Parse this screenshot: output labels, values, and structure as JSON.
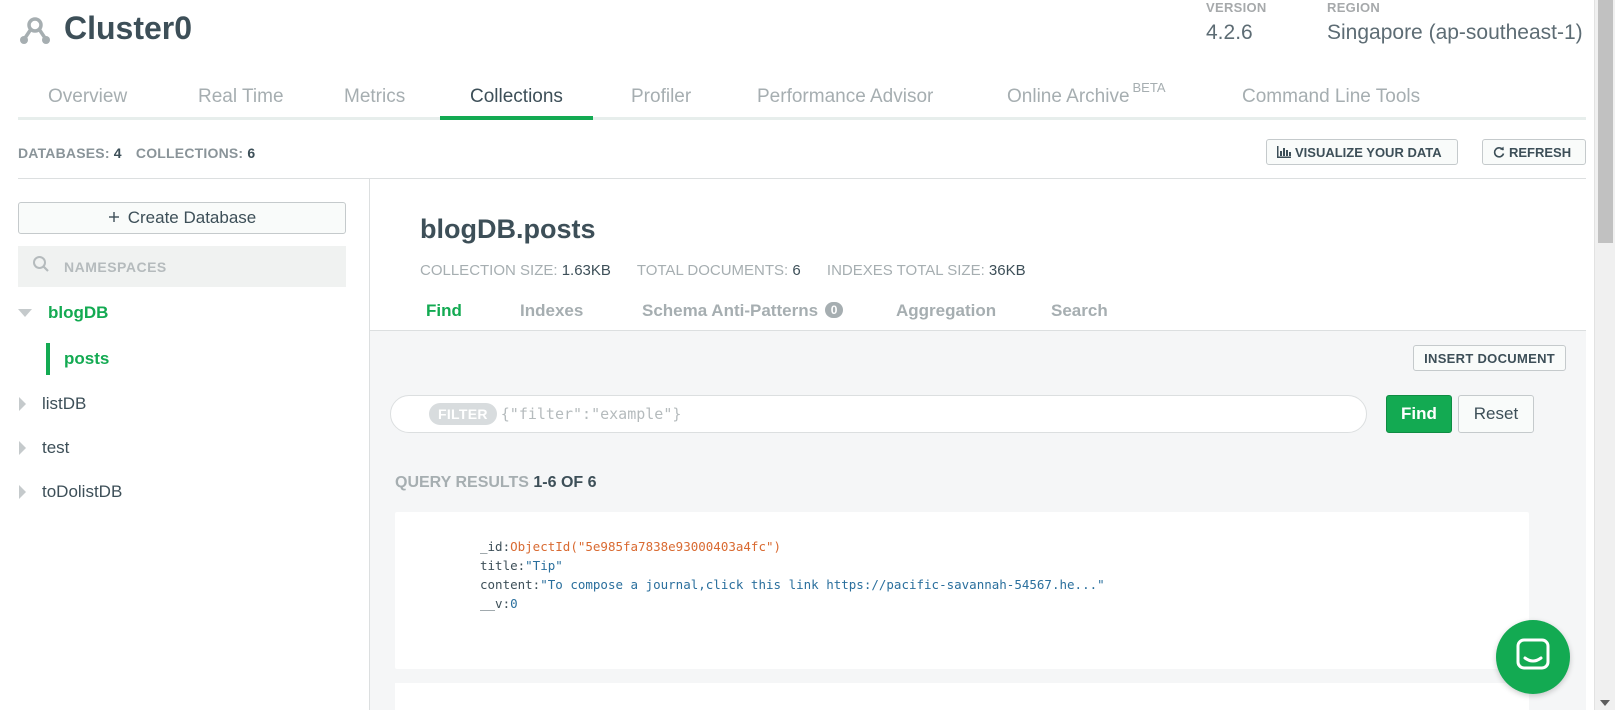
{
  "cluster": {
    "name": "Cluster0",
    "version_label": "VERSION",
    "version_value": "4.2.6",
    "region_label": "REGION",
    "region_value": "Singapore (ap-southeast-1)"
  },
  "tabs": [
    {
      "label": "Overview",
      "active": false
    },
    {
      "label": "Real Time",
      "active": false
    },
    {
      "label": "Metrics",
      "active": false
    },
    {
      "label": "Collections",
      "active": true
    },
    {
      "label": "Profiler",
      "active": false
    },
    {
      "label": "Performance Advisor",
      "active": false
    },
    {
      "label": "Online Archive",
      "sup": "BETA",
      "active": false
    },
    {
      "label": "Command Line Tools",
      "active": false
    }
  ],
  "counts": {
    "databases_label": "DATABASES:",
    "databases_value": "4",
    "collections_label": "COLLECTIONS:",
    "collections_value": "6"
  },
  "toolbar": {
    "visualize_label": "VISUALIZE YOUR DATA",
    "refresh_label": "REFRESH"
  },
  "sidebar": {
    "create_db_label": "Create Database",
    "search_placeholder": "NAMESPACES",
    "databases": [
      {
        "name": "blogDB",
        "expanded": true,
        "collections": [
          "posts"
        ]
      },
      {
        "name": "listDB",
        "expanded": false
      },
      {
        "name": "test",
        "expanded": false
      },
      {
        "name": "toDolistDB",
        "expanded": false
      }
    ]
  },
  "namespace": {
    "title": "blogDB.posts",
    "collection_size_label": "COLLECTION SIZE:",
    "collection_size_value": "1.63KB",
    "total_docs_label": "TOTAL DOCUMENTS:",
    "total_docs_value": "6",
    "indexes_size_label": "INDEXES TOTAL SIZE:",
    "indexes_size_value": "36KB"
  },
  "subtabs": [
    {
      "label": "Find",
      "active": true
    },
    {
      "label": "Indexes",
      "active": false
    },
    {
      "label": "Schema Anti-Patterns",
      "badge": "0",
      "active": false
    },
    {
      "label": "Aggregation",
      "active": false
    },
    {
      "label": "Search",
      "active": false
    }
  ],
  "query": {
    "insert_label": "INSERT DOCUMENT",
    "filter_label": "FILTER",
    "filter_placeholder": "{\"filter\":\"example\"}",
    "find_label": "Find",
    "reset_label": "Reset",
    "results_label": "QUERY RESULTS",
    "results_range": "1-6 OF 6"
  },
  "document": {
    "id_key": "_id:",
    "id_value": "ObjectId(\"5e985fa7838e93000403a4fc\")",
    "title_key": "title:",
    "title_value": "\"Tip\"",
    "content_key": "content:",
    "content_value": "\"To compose a journal,click this link https://pacific-savannah-54567.he...\"",
    "v_key": "__v:",
    "v_value": "0"
  },
  "colors": {
    "accent": "#13aa52",
    "text": "#3d4f58",
    "muted": "#a6aeb1",
    "objectid": "#d96a31",
    "string": "#2a6f9d"
  }
}
